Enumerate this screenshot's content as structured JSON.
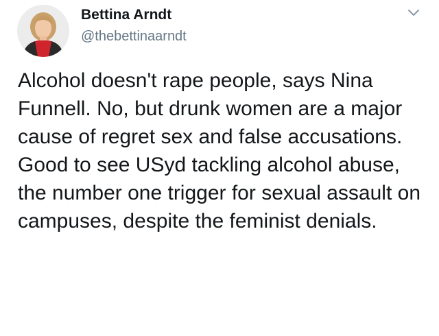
{
  "tweet": {
    "author": {
      "name": "Bettina Arndt",
      "handle": "@thebettinaarndt",
      "avatar_icon": "profile-photo"
    },
    "menu_icon": "chevron-down-icon",
    "text": "Alcohol doesn't rape people, says Nina Funnell. No, but drunk women are a major cause of regret sex and false accusations. Good to see USyd tackling alcohol abuse, the number one trigger for sexual assault on campuses, despite the feminist denials."
  },
  "colors": {
    "text_primary": "#14171a",
    "text_secondary": "#657786",
    "chevron": "#8899a6",
    "background": "#ffffff"
  }
}
